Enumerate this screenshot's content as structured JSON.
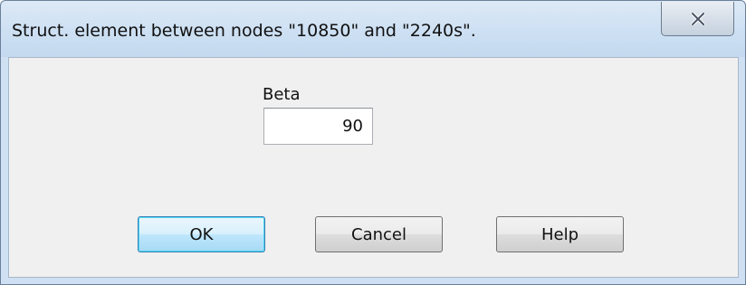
{
  "window": {
    "title": "Struct. element between nodes \"10850\" and \"2240s\"."
  },
  "form": {
    "beta_label": "Beta",
    "beta_value": "90"
  },
  "buttons": {
    "ok_label": "OK",
    "cancel_label": "Cancel",
    "help_label": "Help"
  },
  "icons": {
    "close": "close-icon"
  },
  "colors": {
    "titlebar": "#cde0f3",
    "client_background": "#f0f0f0",
    "default_button_border": "#3c7fb1"
  }
}
